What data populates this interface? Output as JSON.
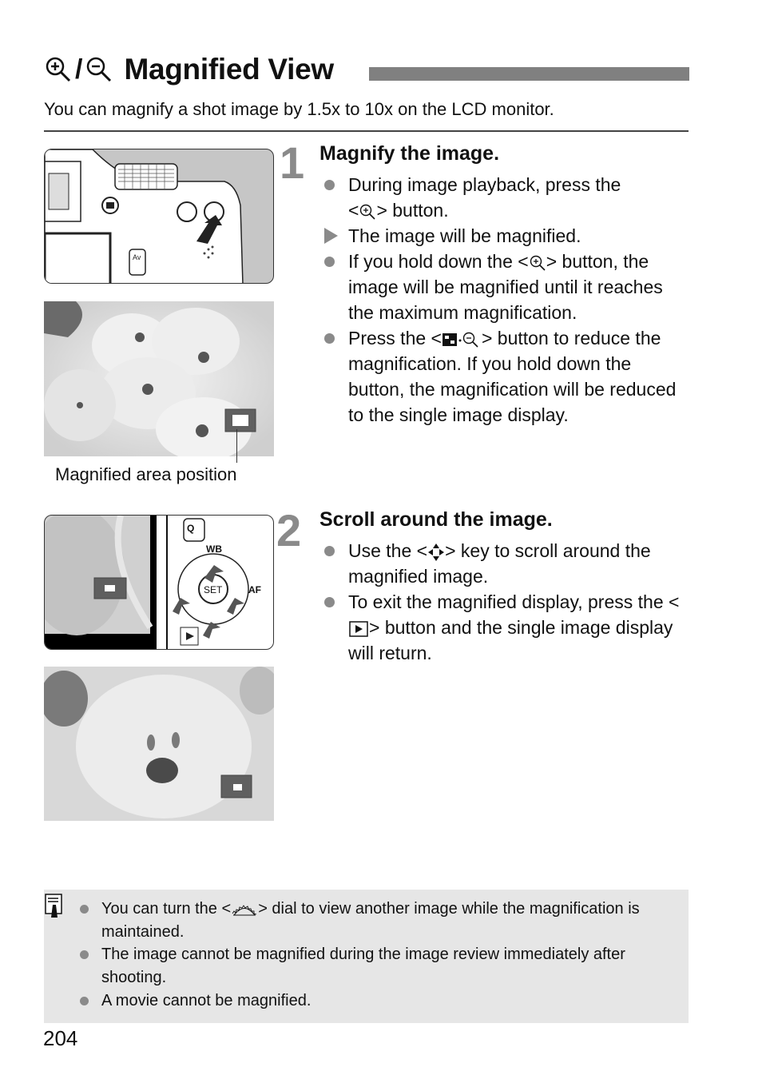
{
  "header": {
    "title": "Magnified View",
    "title_icons": [
      "magnify-plus-icon",
      "magnify-minus-icon"
    ],
    "title_separator": "/"
  },
  "intro": "You can magnify a shot image by 1.5x to 10x on the LCD monitor.",
  "figures": {
    "camera_top_alt": "Camera top-rear view with arrow pointing to the magnify button",
    "flowers_alt": "Playback image of flowers with magnified area indicator",
    "caption": "Magnified area position",
    "camera_back_alt": "Camera rear with cross keys and SET button, arrows indicating scroll directions",
    "camera_back_labels": {
      "q": "Q",
      "wb": "WB",
      "set": "SET",
      "af": "AF"
    },
    "flower_zoom_alt": "Magnified flower image with position indicator"
  },
  "steps": [
    {
      "number": "1",
      "title": "Magnify the image.",
      "bullets": [
        {
          "type": "dot",
          "parts": [
            "During image playback, press the ",
            "<",
            "magnify-plus-icon",
            "> button."
          ]
        },
        {
          "type": "triangle",
          "text": "The image will be magnified."
        },
        {
          "type": "dot",
          "parts": [
            "If you hold down the ",
            "<",
            "magnify-plus-icon",
            "> button, the image will be magnified until it reaches the maximum magnification."
          ]
        },
        {
          "type": "dot",
          "parts": [
            "Press the ",
            "<",
            "index-magnify-minus-icon",
            "> button to reduce the magnification. If you hold down the button, the magnification will be reduced to the single image display."
          ]
        }
      ]
    },
    {
      "number": "2",
      "title": "Scroll around the image.",
      "bullets": [
        {
          "type": "dot",
          "parts": [
            "Use the ",
            "<",
            "cross-keys-icon",
            "> key to scroll around the magnified image."
          ]
        },
        {
          "type": "dot",
          "parts": [
            "To exit the magnified display, press the ",
            "<",
            "playback-icon",
            "> button and the single image display will return."
          ]
        }
      ]
    }
  ],
  "note": {
    "icon": "memo-icon",
    "bullets": [
      {
        "parts": [
          "You can turn the ",
          "<",
          "main-dial-icon",
          "> dial to view another image while the magnification is maintained."
        ]
      },
      {
        "text": "The image cannot be magnified during the image review immediately after shooting."
      },
      {
        "text": "A movie cannot be magnified."
      }
    ]
  },
  "page_number": "204",
  "colors": {
    "title_bar": "#808080",
    "step_number": "#8a8a8a",
    "bullet": "#8a8a8a",
    "note_background": "#e6e6e6"
  }
}
